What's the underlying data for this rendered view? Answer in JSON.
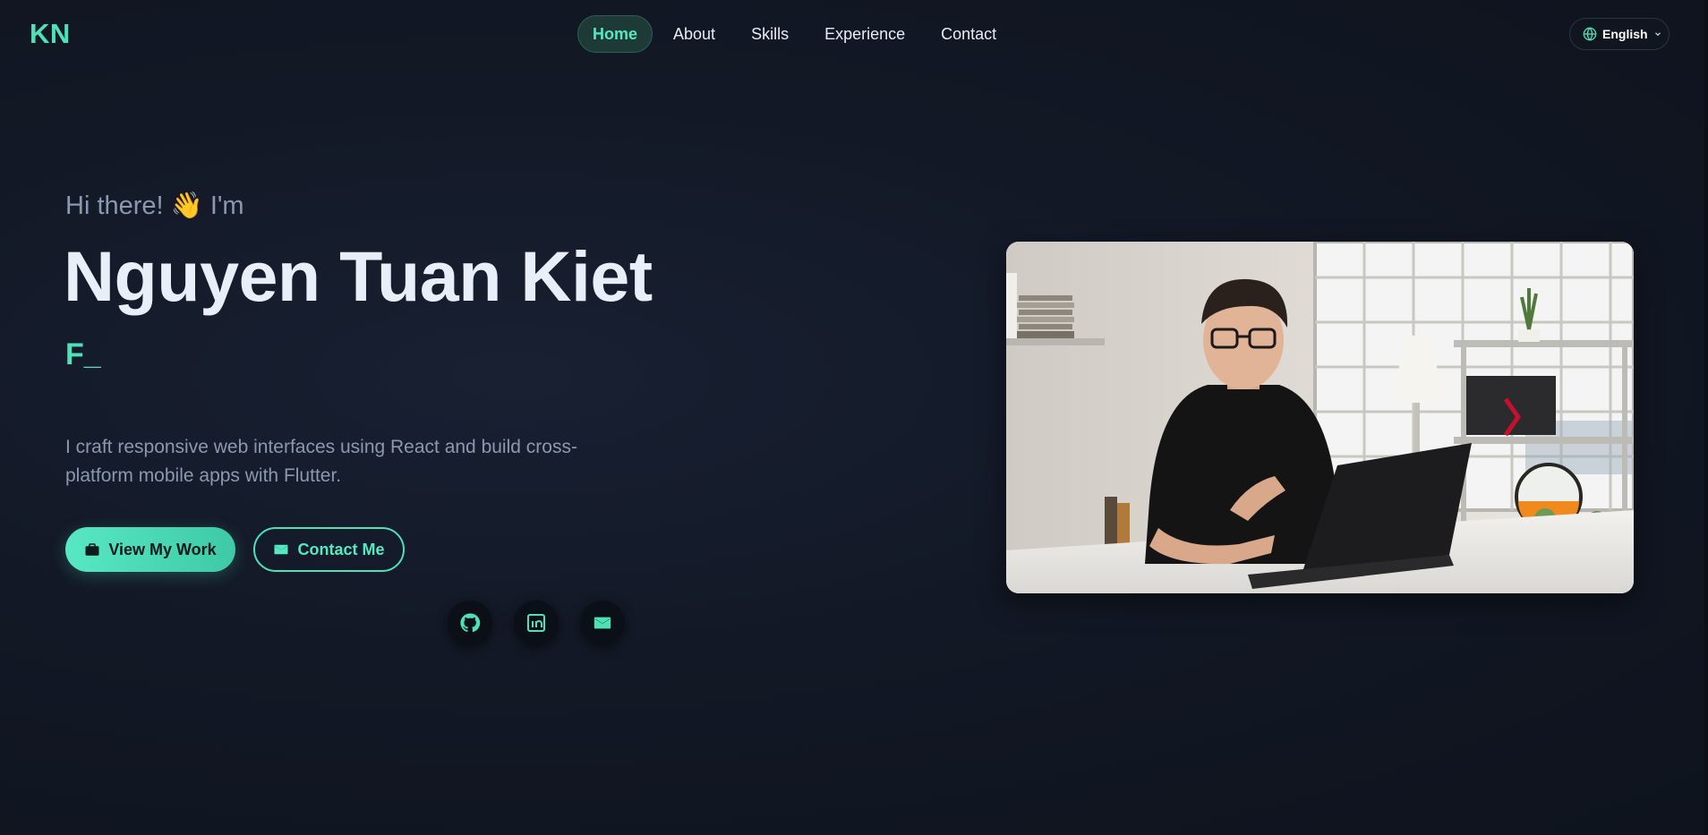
{
  "nav": {
    "logo": "KN",
    "links": [
      "Home",
      "About",
      "Skills",
      "Experience",
      "Contact"
    ],
    "active": "Home",
    "language": "English"
  },
  "hero": {
    "greeting": "Hi there! 👋 I'm",
    "name": "Nguyen Tuan Kiet",
    "typing_text": "F_",
    "description": "I craft responsive web interfaces using React and build cross-platform mobile apps with Flutter.",
    "primary_button": "View My Work",
    "secondary_button": "Contact Me",
    "socials": [
      "github-icon",
      "linkedin-icon",
      "mail-icon"
    ]
  },
  "colors": {
    "accent": "#4fe0b8",
    "background": "#121825",
    "text_muted": "#8b98b1"
  }
}
